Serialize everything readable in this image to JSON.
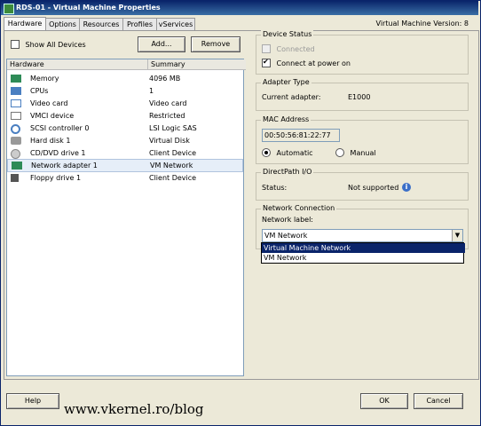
{
  "window": {
    "title": "RDS-01 - Virtual Machine Properties"
  },
  "tabs": [
    {
      "label": "Hardware"
    },
    {
      "label": "Options"
    },
    {
      "label": "Resources"
    },
    {
      "label": "Profiles"
    },
    {
      "label": "vServices"
    }
  ],
  "version_label": "Virtual Machine Version: 8",
  "left": {
    "show_all_devices": "Show All Devices",
    "add_button": "Add...",
    "remove_button": "Remove",
    "columns": {
      "hardware": "Hardware",
      "summary": "Summary"
    },
    "devices": [
      {
        "name": "Memory",
        "summary": "4096 MB",
        "icon": "memory-icon",
        "color": "#2e8b57"
      },
      {
        "name": "CPUs",
        "summary": "1",
        "icon": "cpu-icon",
        "color": "#4a7fc1"
      },
      {
        "name": "Video card",
        "summary": "Video card",
        "icon": "monitor-icon",
        "color": "#4a7fc1"
      },
      {
        "name": "VMCI device",
        "summary": "Restricted",
        "icon": "vmci-icon",
        "color": "#777777"
      },
      {
        "name": "SCSI controller 0",
        "summary": "LSI Logic SAS",
        "icon": "scsi-controller-icon",
        "color": "#4a7fc1"
      },
      {
        "name": "Hard disk 1",
        "summary": "Virtual Disk",
        "icon": "hard-disk-icon",
        "color": "#777777"
      },
      {
        "name": "CD/DVD drive 1",
        "summary": "Client Device",
        "icon": "cd-dvd-icon",
        "color": "#888888"
      },
      {
        "name": "Network adapter 1",
        "summary": "VM Network",
        "icon": "network-adapter-icon",
        "color": "#2e8b57",
        "selected": true
      },
      {
        "name": "Floppy drive 1",
        "summary": "Client Device",
        "icon": "floppy-icon",
        "color": "#555555"
      }
    ]
  },
  "device_status": {
    "title": "Device Status",
    "connected": "Connected",
    "connect_at_power_on": "Connect at power on"
  },
  "adapter_type": {
    "title": "Adapter Type",
    "label": "Current adapter:",
    "value": "E1000"
  },
  "mac_address": {
    "title": "MAC Address",
    "value": "00:50:56:81:22:77",
    "automatic": "Automatic",
    "manual": "Manual"
  },
  "directpath": {
    "title": "DirectPath I/O",
    "label": "Status:",
    "value": "Not supported"
  },
  "network_connection": {
    "title": "Network Connection",
    "label": "Network label:",
    "selected": "VM Network",
    "options": [
      "Virtual Machine Network",
      "VM Network"
    ]
  },
  "footer": {
    "help": "Help",
    "ok": "OK",
    "cancel": "Cancel"
  },
  "watermark": "www.vkernel.ro/blog"
}
